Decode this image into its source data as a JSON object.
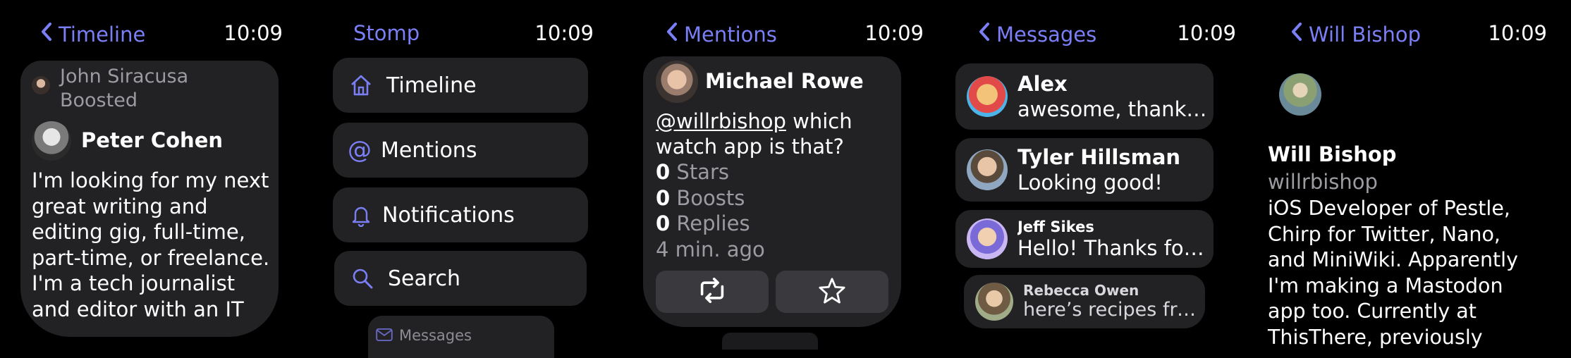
{
  "screens": {
    "timeline": {
      "back_label": "Timeline",
      "time": "10:09",
      "boost_user": "John Siracusa",
      "boost_text": "Boosted",
      "author": "Peter Cohen",
      "body": "I'm looking for my next great writing and editing gig, full-time, part-time, or freelance. I'm a tech journalist and editor with an IT"
    },
    "menu": {
      "title": "Stomp",
      "time": "10:09",
      "items": [
        {
          "label": "Timeline",
          "icon": "house-icon"
        },
        {
          "label": "Mentions",
          "icon": "at-icon"
        },
        {
          "label": "Notifications",
          "icon": "bell-icon"
        },
        {
          "label": "Search",
          "icon": "magnifier-icon"
        },
        {
          "label": "Messages",
          "icon": "envelope-icon"
        }
      ]
    },
    "mentions": {
      "back_label": "Mentions",
      "time": "10:09",
      "author": "Michael Rowe",
      "mention": "@willrbishop",
      "body_rest": " which watch app is that?",
      "stars_count": "0",
      "stars_label": "Stars",
      "boosts_count": "0",
      "boosts_label": "Boosts",
      "replies_count": "0",
      "replies_label": "Replies",
      "age": "4 min. ago"
    },
    "messages": {
      "back_label": "Messages",
      "time": "10:09",
      "threads": [
        {
          "name": "Alex",
          "snippet": "awesome, thanks for..."
        },
        {
          "name": "Tyler Hillsman",
          "snippet": "Looking good!"
        },
        {
          "name": "Jeff Sikes",
          "snippet": "Hello! Thanks for..."
        },
        {
          "name": "Rebecca Owen",
          "snippet": "here’s recipes from..."
        }
      ]
    },
    "profile": {
      "back_label": "Will Bishop",
      "time": "10:09",
      "display_name": "Will Bishop",
      "handle": "willrbishop",
      "bio": "iOS Developer of Pestle, Chirp for Twitter, Nano, and MiniWiki. Apparently I'm making a Mastodon app too. Currently at ThisThere, previously"
    }
  },
  "colors": {
    "accent": "#7b7ff6",
    "card": "#222225",
    "muted": "#9b9ba1",
    "background": "#000000"
  }
}
